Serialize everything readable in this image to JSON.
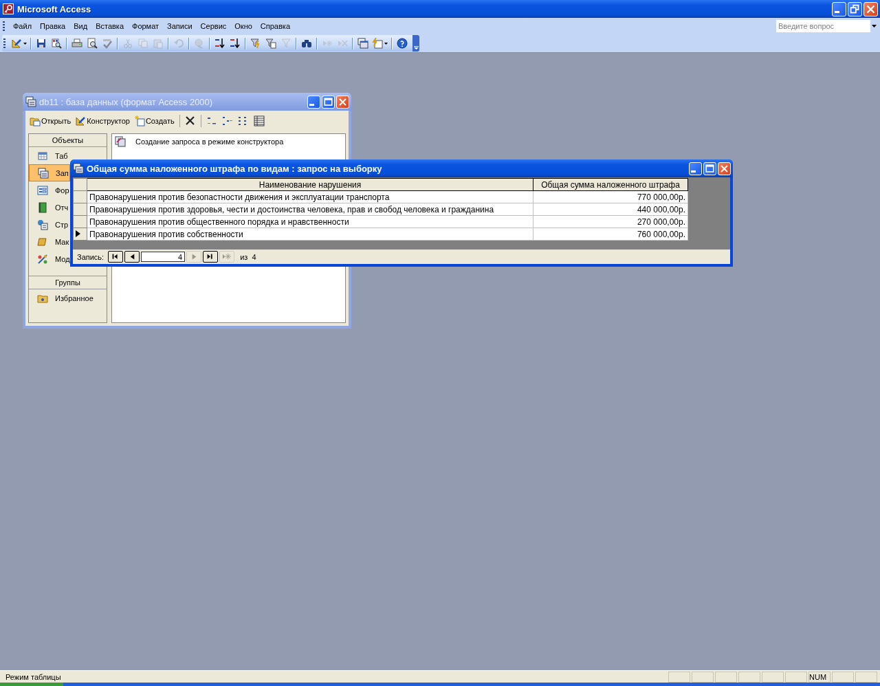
{
  "app_window": {
    "title": "Microsoft Access"
  },
  "menu": [
    {
      "label": "Файл"
    },
    {
      "label": "Правка"
    },
    {
      "label": "Вид"
    },
    {
      "label": "Вставка"
    },
    {
      "label": "Формат"
    },
    {
      "label": "Записи"
    },
    {
      "label": "Сервис"
    },
    {
      "label": "Окно"
    },
    {
      "label": "Справка"
    }
  ],
  "help_box": {
    "placeholder": "Введите вопрос"
  },
  "toolbar": [
    {
      "kind": "design",
      "disabled": false
    },
    {
      "kind": "separator"
    },
    {
      "kind": "save",
      "disabled": false
    },
    {
      "kind": "file-search",
      "disabled": false
    },
    {
      "kind": "separator"
    },
    {
      "kind": "print",
      "disabled": false
    },
    {
      "kind": "preview",
      "disabled": false
    },
    {
      "kind": "spelling",
      "disabled": false
    },
    {
      "kind": "separator"
    },
    {
      "kind": "cut",
      "disabled": true
    },
    {
      "kind": "copy",
      "disabled": true
    },
    {
      "kind": "paste",
      "disabled": true
    },
    {
      "kind": "separator"
    },
    {
      "kind": "undo",
      "disabled": true
    },
    {
      "kind": "separator"
    },
    {
      "kind": "hyperlink",
      "disabled": true
    },
    {
      "kind": "separator"
    },
    {
      "kind": "sort-asc",
      "disabled": false
    },
    {
      "kind": "sort-desc",
      "disabled": false
    },
    {
      "kind": "separator"
    },
    {
      "kind": "filter-selection",
      "disabled": false
    },
    {
      "kind": "filter-form",
      "disabled": false
    },
    {
      "kind": "apply-filter",
      "disabled": true
    },
    {
      "kind": "separator"
    },
    {
      "kind": "find",
      "disabled": false
    },
    {
      "kind": "separator"
    },
    {
      "kind": "new-record",
      "disabled": true
    },
    {
      "kind": "delete-record",
      "disabled": true
    },
    {
      "kind": "separator"
    },
    {
      "kind": "db-window",
      "disabled": false
    },
    {
      "kind": "new-object",
      "disabled": false
    },
    {
      "kind": "separator"
    },
    {
      "kind": "help",
      "disabled": false
    }
  ],
  "db_window": {
    "title": "db11 : база данных (формат Access 2000)",
    "toolbar": [
      {
        "kind": "open",
        "label": "Открыть"
      },
      {
        "kind": "design",
        "label": "Конструктор"
      },
      {
        "kind": "new",
        "label": "Создать"
      },
      {
        "kind": "separator"
      },
      {
        "kind": "delete"
      },
      {
        "kind": "separator"
      },
      {
        "kind": "large-icons"
      },
      {
        "kind": "small-icons"
      },
      {
        "kind": "list"
      },
      {
        "kind": "details"
      }
    ],
    "objects_header": "Объекты",
    "objects": [
      {
        "kind": "table",
        "label": "Таб",
        "selected": false
      },
      {
        "kind": "query",
        "label": "Зап",
        "selected": true
      },
      {
        "kind": "form",
        "label": "Фор",
        "selected": false
      },
      {
        "kind": "report",
        "label": "Отч",
        "selected": false
      },
      {
        "kind": "page",
        "label": "Стр",
        "selected": false
      },
      {
        "kind": "macro",
        "label": "Мак",
        "selected": false
      },
      {
        "kind": "module",
        "label": "Мод",
        "selected": false
      }
    ],
    "groups_header": "Группы",
    "groups": [
      {
        "label": "Избранное"
      }
    ],
    "items": [
      {
        "label": "Создание запроса в режиме конструктора"
      }
    ]
  },
  "query_window": {
    "title": "Общая сумма наложенного штрафа по видам : запрос на выборку",
    "columns": [
      "Наименование нарушения",
      "Общая сумма наложенного штрафа"
    ],
    "rows": [
      {
        "name": "Правонарушения против безопастности движения и эксплуатации транспорта",
        "total": "770 000,00р.",
        "selected": false
      },
      {
        "name": "Правонарушения против здоровья, чести и достоинства человека, прав и свобод человека и гражданина",
        "total": "440 000,00р.",
        "selected": false
      },
      {
        "name": "Правонарушения против общественного порядка и нравственности",
        "total": "270 000,00р.",
        "selected": false
      },
      {
        "name": "Правонарушения против собственности",
        "total": "760 000,00р.",
        "selected": true
      }
    ],
    "navigator": {
      "label": "Запись:",
      "record": "4",
      "total": "из  4",
      "buttons": [
        {
          "kind": "first",
          "disabled": false
        },
        {
          "kind": "prev",
          "disabled": false
        },
        {
          "kind": "field"
        },
        {
          "kind": "next",
          "disabled": true
        },
        {
          "kind": "last",
          "disabled": false
        },
        {
          "kind": "new",
          "disabled": true
        }
      ]
    }
  },
  "status_bar": {
    "text": "Режим таблицы",
    "indicators": [
      "NUM"
    ]
  }
}
